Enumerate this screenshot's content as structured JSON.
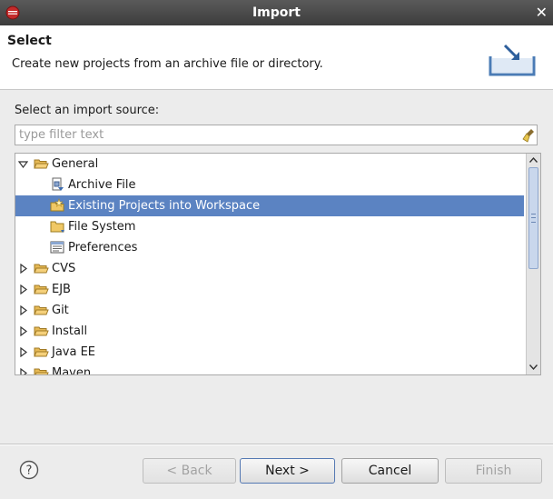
{
  "window": {
    "title": "Import"
  },
  "header": {
    "title": "Select",
    "description": "Create new projects from an archive file or directory."
  },
  "source_label": "Select an import source:",
  "filter": {
    "placeholder": "type filter text",
    "value": ""
  },
  "tree": {
    "items": [
      {
        "label": "General",
        "level": 0,
        "expanded": true,
        "icon": "open-folder-icon"
      },
      {
        "label": "Archive File",
        "level": 1,
        "icon": "archive-file-icon"
      },
      {
        "label": "Existing Projects into Workspace",
        "level": 1,
        "icon": "existing-projects-icon",
        "selected": true
      },
      {
        "label": "File System",
        "level": 1,
        "icon": "folder-icon"
      },
      {
        "label": "Preferences",
        "level": 1,
        "icon": "preferences-icon"
      },
      {
        "label": "CVS",
        "level": 0,
        "expanded": false,
        "icon": "folder-icon"
      },
      {
        "label": "EJB",
        "level": 0,
        "expanded": false,
        "icon": "folder-icon"
      },
      {
        "label": "Git",
        "level": 0,
        "expanded": false,
        "icon": "folder-icon"
      },
      {
        "label": "Install",
        "level": 0,
        "expanded": false,
        "icon": "folder-icon"
      },
      {
        "label": "Java EE",
        "level": 0,
        "expanded": false,
        "icon": "folder-icon"
      },
      {
        "label": "Maven",
        "level": 0,
        "expanded": false,
        "icon": "folder-icon"
      }
    ]
  },
  "buttons": {
    "back": "< Back",
    "next": "Next >",
    "cancel": "Cancel",
    "finish": "Finish"
  },
  "colors": {
    "selection": "#5b83c2",
    "titlebar": "#4a4a4a"
  }
}
